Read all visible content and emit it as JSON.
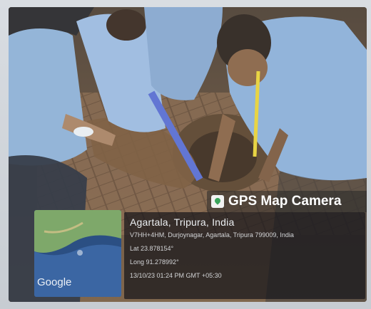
{
  "overlay": {
    "app_title": "GPS Map Camera",
    "map_label": "Google",
    "place": "Agartala, Tripura, India",
    "address": "V7HH+4HM, Durjoynagar, Agartala, Tripura 799009, India",
    "latitude": "Lat 23.878154°",
    "longitude": "Long 91.278992°",
    "datetime": "13/10/23 01:24 PM GMT +05:30"
  },
  "icons": {
    "logo": "map-pin-icon"
  },
  "colors": {
    "header_bg": "#3a3a3a",
    "uniform_blue": "#8fb2d6",
    "soil": "#6e5338",
    "map_green": "#7ea86a"
  }
}
